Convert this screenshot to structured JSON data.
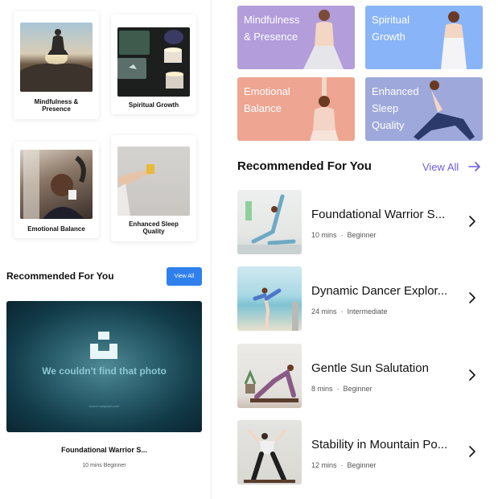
{
  "left": {
    "categories": [
      {
        "label": "Mindfulness &\nPresence",
        "image": "meditation-on-rock"
      },
      {
        "label": "Spiritual Growth",
        "image": "candles-and-stones"
      },
      {
        "label": "Emotional Balance",
        "image": "woman-with-coffee"
      },
      {
        "label": "Enhanced Sleep\nQuality",
        "image": "hand-holding-object"
      }
    ],
    "recommended_title": "Recommended For You",
    "view_all_label": "View All",
    "missing_photo_message": "We couldn't find that photo",
    "missing_photo_url": "source.unsplash.com",
    "featured": {
      "name": "Foundational Warrior S...",
      "meta": "10 mins Beginner"
    }
  },
  "right": {
    "tiles": [
      {
        "label": "Mindfulness\n& Presence",
        "color": "#b39ddb"
      },
      {
        "label": "Spiritual\nGrowth",
        "color": "#89b4f8"
      },
      {
        "label": "Emotional\nBalance",
        "color": "#eea592"
      },
      {
        "label": "Enhanced\nSleep\nQuality",
        "color": "#9fa8da"
      }
    ],
    "recommended_title": "Recommended For You",
    "view_all_label": "View All",
    "items": [
      {
        "name": "Foundational Warrior S...",
        "duration": "10 mins",
        "level": "Beginner"
      },
      {
        "name": "Dynamic Dancer Explor...",
        "duration": "24 mins",
        "level": "Intermediate"
      },
      {
        "name": "Gentle Sun Salutation",
        "duration": "8 mins",
        "level": "Beginner"
      },
      {
        "name": "Stability in Mountain Po...",
        "duration": "12 mins",
        "level": "Beginner"
      }
    ],
    "separator": "·"
  },
  "icons": {
    "arrow": "arrow-right-icon",
    "chevron": "chevron-right-icon"
  },
  "colors": {
    "accent": "#6c5ce7",
    "button_blue": "#2f80ed"
  }
}
